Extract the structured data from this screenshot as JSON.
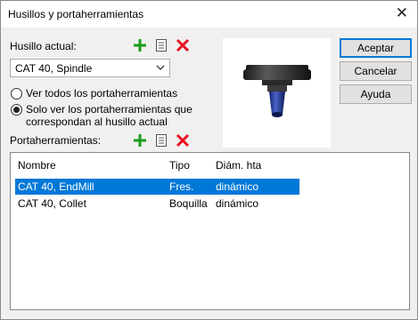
{
  "window": {
    "title": "Husillos y portaherramientas",
    "close_glyph": "✕"
  },
  "spindle": {
    "label": "Husillo actual:",
    "selected": "CAT 40, Spindle",
    "icons": [
      "plus-icon",
      "list-icon",
      "delete-icon"
    ]
  },
  "filter": {
    "option_all": "Ver todos los portaherramientas",
    "option_matching_line1": "Solo ver los portaherramientas que",
    "option_matching_line2": "correspondan al husillo actual",
    "selected": "matching"
  },
  "holders": {
    "label": "Portaherramientas:",
    "columns": [
      "Nombre",
      "Tipo",
      "Diám. hta"
    ],
    "rows": [
      {
        "name": "CAT 40, EndMill",
        "type": "Fres.",
        "diameter": "dinámico",
        "selected": true
      },
      {
        "name": "CAT 40, Collet",
        "type": "Boquilla",
        "diameter": "dinámico",
        "selected": false
      }
    ]
  },
  "buttons": {
    "ok": "Aceptar",
    "cancel": "Cancelar",
    "help": "Ayuda"
  },
  "colors": {
    "accent": "#0078d7",
    "add": "#1a9b1a",
    "delete": "#e81123"
  }
}
